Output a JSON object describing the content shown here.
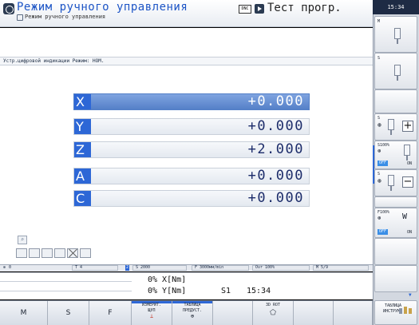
{
  "header": {
    "mode_title": "Режим ручного управления",
    "mode_subtitle": "Режим ручного управления",
    "dnc_badge": "DNC",
    "program_title": "Тест прогр."
  },
  "clock": "15:34",
  "info_bar": "Устр.цифровой индикации Режим: НОМ.",
  "axes": [
    {
      "letter": "X",
      "value": "+0.000",
      "active": true
    },
    {
      "letter": "Y",
      "value": "+0.000",
      "active": false
    },
    {
      "letter": "Z",
      "value": "+2.000",
      "active": false
    },
    {
      "letter": "A",
      "value": "+0.000",
      "active": false
    },
    {
      "letter": "C",
      "value": "+0.000",
      "active": false
    }
  ],
  "status_bar": {
    "tool_index": "0",
    "tool": "T 4",
    "spindle_flag": "2",
    "spindle_speed": "S 2000",
    "feed": "F 3000мм/min",
    "override": "Ovr 100%",
    "m_functions": "M 5/9"
  },
  "position": {
    "line1": "0% X[Nm]",
    "line2": "0% Y[Nm]",
    "spindle_label": "S1",
    "time": "15:34"
  },
  "softkeys": {
    "m": "M",
    "s": "S",
    "f": "F",
    "probe_line1": "ИЗМЕРИТ.",
    "probe_line2": "ЩУП",
    "preset_line1": "ТАБЛИЦА",
    "preset_line2": "ПРЕДУСТ.",
    "rot_label": "3D ROT"
  },
  "right_panel": {
    "m_label": "M",
    "s_label": "S",
    "s_plus_label": "S",
    "s100_label": "S100%",
    "s_minus_label": "S",
    "f100_label": "F100%",
    "off": "OFF",
    "on": "ON",
    "plus": "+",
    "minus": "−",
    "tool_table_line1": "ТАБЛИЦА",
    "tool_table_line2": "ИНСТРУМ."
  }
}
